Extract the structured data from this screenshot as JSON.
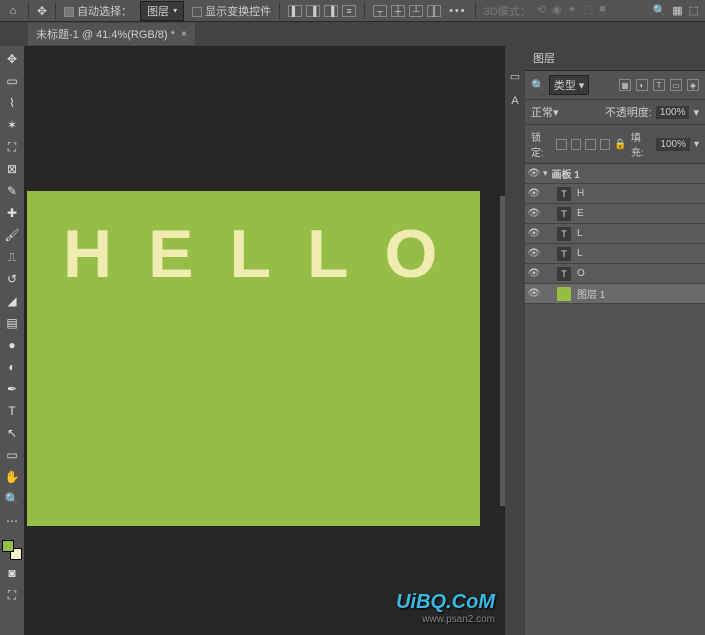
{
  "toolbar": {
    "auto_select_label": "自动选择：",
    "auto_select_target": "图层",
    "show_transform": "显示变换控件",
    "mode_3d": "3D模式："
  },
  "tab": {
    "title": "未标题-1 @ 41.4%(RGB/8) *"
  },
  "canvas": {
    "text": "HELLO"
  },
  "panel": {
    "title": "图层",
    "filter_label": "类型",
    "blend_mode": "正常",
    "opacity_label": "不透明度:",
    "opacity_value": "100%",
    "lock_label": "锁定:",
    "fill_label": "填充:",
    "fill_value": "100%"
  },
  "layers": {
    "artboard": "画板 1",
    "items": [
      {
        "type": "T",
        "name": "H"
      },
      {
        "type": "T",
        "name": "E"
      },
      {
        "type": "T",
        "name": "L"
      },
      {
        "type": "T",
        "name": "L"
      },
      {
        "type": "T",
        "name": "O"
      }
    ],
    "bg": "图层 1"
  },
  "watermark": {
    "main": "UiBQ.CoM",
    "sub": "www.psan2.com"
  }
}
